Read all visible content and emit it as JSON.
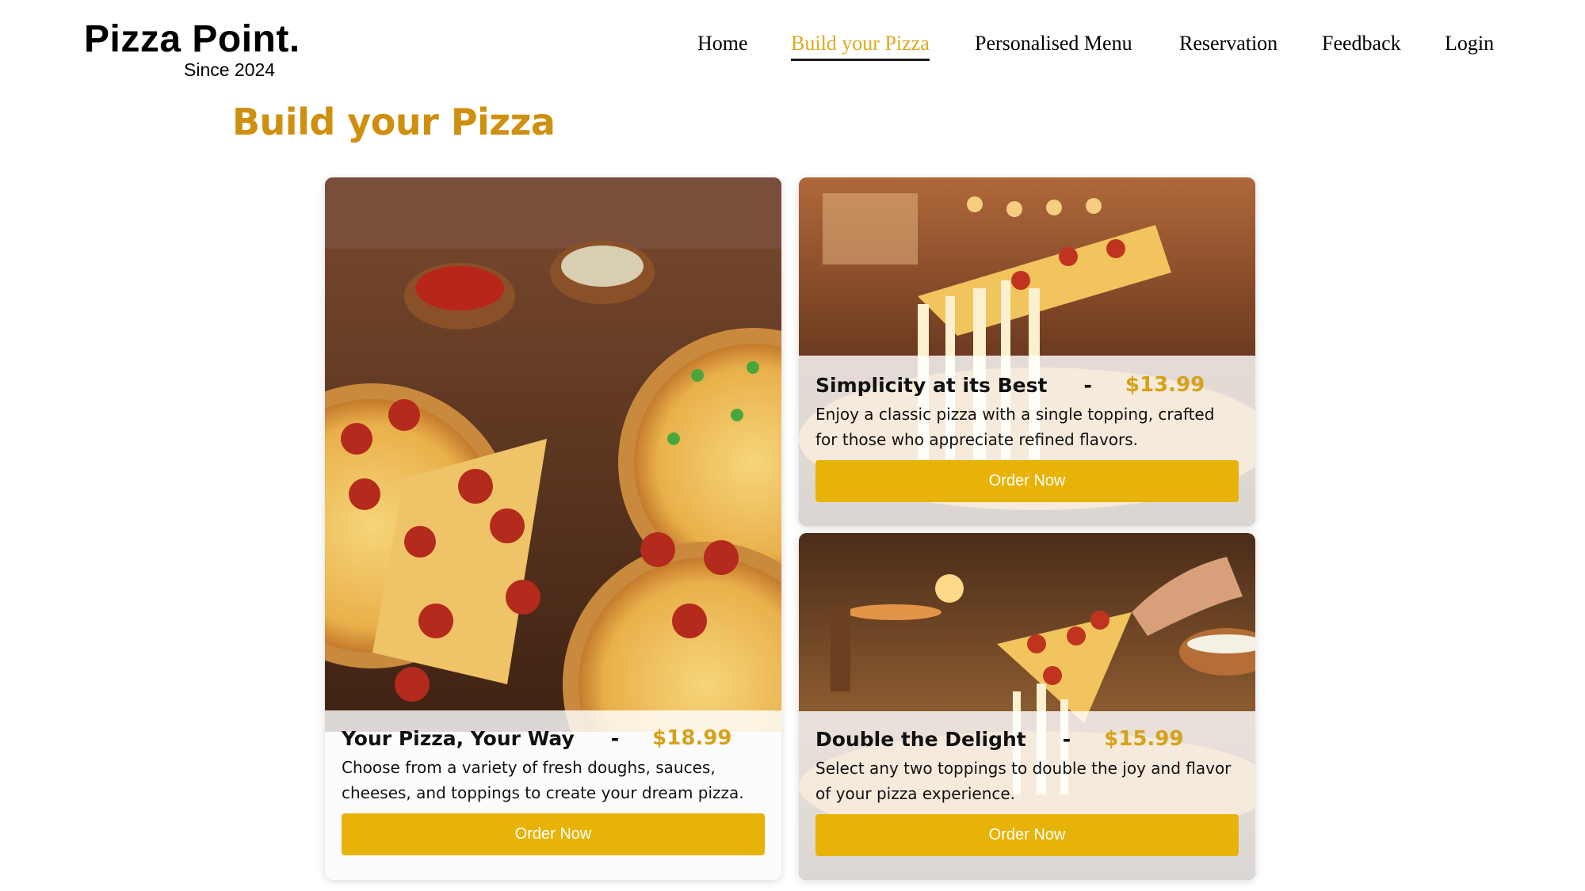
{
  "brand": {
    "name": "Pizza Point.",
    "since": "Since 2024"
  },
  "nav": {
    "items": [
      {
        "label": "Home"
      },
      {
        "label": "Build your Pizza",
        "active": true
      },
      {
        "label": "Personalised Menu"
      },
      {
        "label": "Reservation"
      },
      {
        "label": "Feedback"
      },
      {
        "label": "Login"
      }
    ]
  },
  "page": {
    "title": "Build your Pizza"
  },
  "cards": [
    {
      "title": "Your Pizza, Your Way",
      "separator": "-",
      "price": "$18.99",
      "description": "Choose from a variety of fresh doughs, sauces, cheeses, and toppings to create your dream pizza.",
      "button": "Order Now"
    },
    {
      "title": "Simplicity at its Best",
      "separator": "-",
      "price": "$13.99",
      "description": "Enjoy a classic pizza with a single topping, crafted for those who appreciate refined flavors.",
      "button": "Order Now"
    },
    {
      "title": "Double the Delight",
      "separator": "-",
      "price": "$15.99",
      "description": "Select any two toppings to double the joy and flavor of your pizza experience.",
      "button": "Order Now"
    }
  ],
  "theme": {
    "accent": "#e8b308",
    "title_color": "#cf8f0f",
    "price_color": "#d6a21a",
    "active_nav": "#e0a81c"
  }
}
